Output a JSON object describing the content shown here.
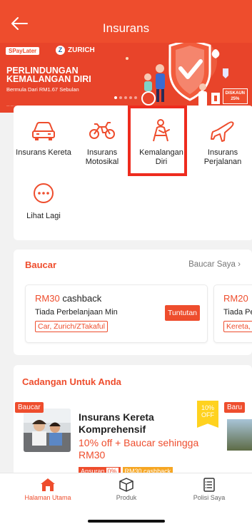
{
  "header": {
    "title": "Insurans"
  },
  "banner": {
    "brand_spay": "SPayLater",
    "brand_zurich": "ZURICH",
    "headline_1": "PERLINDUNGAN",
    "headline_2": "KEMALANGAN DIRI",
    "subline": "Bermula Dari RM1.67 Sebulan",
    "discount_1": "DISKAUN",
    "discount_2": "25%"
  },
  "categories": [
    {
      "label": "Insurans Kereta",
      "icon": "car-icon"
    },
    {
      "label": "Insurans Motosikal",
      "icon": "motorcycle-icon"
    },
    {
      "label": "Kemalangan Diri",
      "icon": "personal-accident-icon"
    },
    {
      "label": "Insurans Perjalanan",
      "icon": "airplane-icon"
    },
    {
      "label": "Lihat Lagi",
      "icon": "more-icon"
    }
  ],
  "vouchers": {
    "title": "Baucar",
    "link": "Baucar Saya",
    "items": [
      {
        "amount": "RM30",
        "suffix": "cashback",
        "min": "Tiada Perbelanjaan Min",
        "tag": "Car, Zurich/ZTakaful",
        "claim": "Tuntutan"
      },
      {
        "amount": "RM20",
        "suffix": "",
        "min": "Tiada Pe",
        "tag": "Kereta,"
      }
    ]
  },
  "recommendations": {
    "title": "Cadangan Untuk Anda",
    "items": [
      {
        "badge": "Baucar",
        "ribbon_1": "10%",
        "ribbon_2": "OFF",
        "name": "Insurans Kereta Komprehensif",
        "desc": "10% off + Baucar sehingga RM30",
        "tag1": "Ansuran",
        "tag1_value": "0%",
        "tag2": "RM30 cashback"
      },
      {
        "badge": "Baru"
      }
    ]
  },
  "bottom_nav": [
    {
      "label": "Halaman Utama",
      "icon": "home-icon",
      "active": true
    },
    {
      "label": "Produk",
      "icon": "box-icon"
    },
    {
      "label": "Polisi Saya",
      "icon": "policy-icon"
    }
  ],
  "colors": {
    "accent": "#ee4d2d",
    "highlight_box": "#ee2b1e",
    "ribbon": "#ffd21f",
    "tag_orange": "#f6a623"
  }
}
